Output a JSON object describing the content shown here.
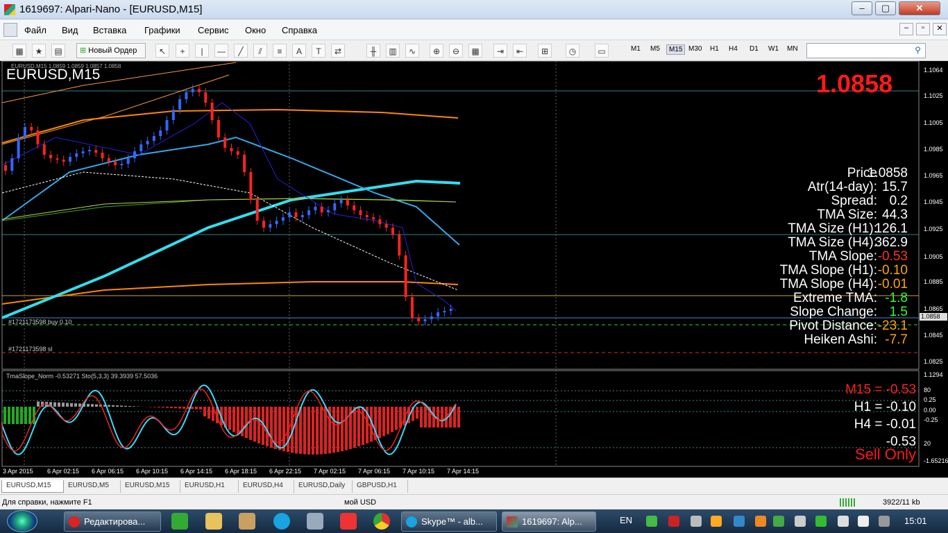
{
  "window": {
    "title": "1619697: Alpari-Nano - [EURUSD,M15]",
    "controls": [
      "–",
      "▢",
      "✕"
    ]
  },
  "menu": [
    "Файл",
    "Вид",
    "Вставка",
    "Графики",
    "Сервис",
    "Окно",
    "Справка"
  ],
  "toolbar": {
    "new_order": "Новый Ордер",
    "timeframes": [
      "M1",
      "M5",
      "M15",
      "M30",
      "H1",
      "H4",
      "D1",
      "W1",
      "MN"
    ],
    "selected_tf": "M15"
  },
  "chart": {
    "symbol": "EURUSD,M15",
    "header": "EURUSD,M15  1.0859 1.0859 1.0857 1.0858",
    "big_price": "1.0858",
    "stats": [
      {
        "label": "Price",
        "value": "1.0858",
        "color": "#ffffff"
      },
      {
        "label": "Atr(14-day):",
        "value": "15.7",
        "color": "#ffffff"
      },
      {
        "label": "Spread:",
        "value": "0.2",
        "color": "#ffffff"
      },
      {
        "label": "TMA Size:",
        "value": "44.3",
        "color": "#ffffff"
      },
      {
        "label": "TMA Size (H1):",
        "value": "126.1",
        "color": "#ffffff"
      },
      {
        "label": "TMA Size (H4):",
        "value": "362.9",
        "color": "#ffffff"
      },
      {
        "label": "TMA Slope:",
        "value": "-0.53",
        "color": "#ff3030"
      },
      {
        "label": "TMA Slope (H1):",
        "value": "-0.10",
        "color": "#ffa500"
      },
      {
        "label": "TMA Slope (H4):",
        "value": "-0.01",
        "color": "#ffa500"
      },
      {
        "label": "Extreme TMA:",
        "value": "-1.8",
        "color": "#33ff33"
      },
      {
        "label": "Slope Change:",
        "value": "1.5",
        "color": "#33ff33"
      },
      {
        "label": "Pivot Distance:",
        "value": "-23.1",
        "color": "#ffa500"
      },
      {
        "label": "Heiken Ashi:",
        "value": "-7.7",
        "color": "#ffa500"
      }
    ],
    "price_axis": [
      "1.1064",
      "1.1025",
      "1.1005",
      "1.0985",
      "1.0965",
      "1.0945",
      "1.0925",
      "1.0905",
      "1.0885",
      "1.0865",
      "1.0858",
      "1.0845",
      "1.0825"
    ],
    "price_tag": "1.0858",
    "order_labels": [
      "#1721173598 buy 0.10",
      "#1721173598 sl"
    ],
    "sub_header": "TmaSlope_Norm -0.53271  Sto(5,3,3) 39.3939 57.5036",
    "sub_axis": [
      "1.1294",
      "80",
      "0.25",
      "0.00",
      "-0.25",
      "20",
      "-1.65216"
    ],
    "tf_slopes": [
      {
        "text": "M15 = -0.53",
        "color": "#ff2020"
      },
      {
        "text": "H1 = -0.10",
        "color": "#ffffff"
      },
      {
        "text": "H4 = -0.01",
        "color": "#ffffff"
      },
      {
        "text": "-0.53",
        "color": "#ffffff"
      }
    ],
    "sell_only": "Sell Only",
    "time_axis": [
      "3 Apr 2015",
      "6 Apr 02:15",
      "6 Apr 06:15",
      "6 Apr 10:15",
      "6 Apr 14:15",
      "6 Apr 18:15",
      "6 Apr 22:15",
      "7 Apr 02:15",
      "7 Apr 06:15",
      "7 Apr 10:15",
      "7 Apr 14:15"
    ]
  },
  "tabs": [
    "EURUSD,M15",
    "EURUSD,M5",
    "EURUSD,M15",
    "EURUSD,H1",
    "EURUSD,H4",
    "EURUSD,Daily",
    "GBPUSD,H1"
  ],
  "status": {
    "help": "Для справки, нажмите F1",
    "profile": "мой USD",
    "traffic": "3922/11 kb"
  },
  "taskbar": {
    "items": [
      "Редактирова...",
      "Skype™ - alb...",
      "1619697: Alp..."
    ],
    "lang": "EN",
    "clock": "15:01"
  }
}
